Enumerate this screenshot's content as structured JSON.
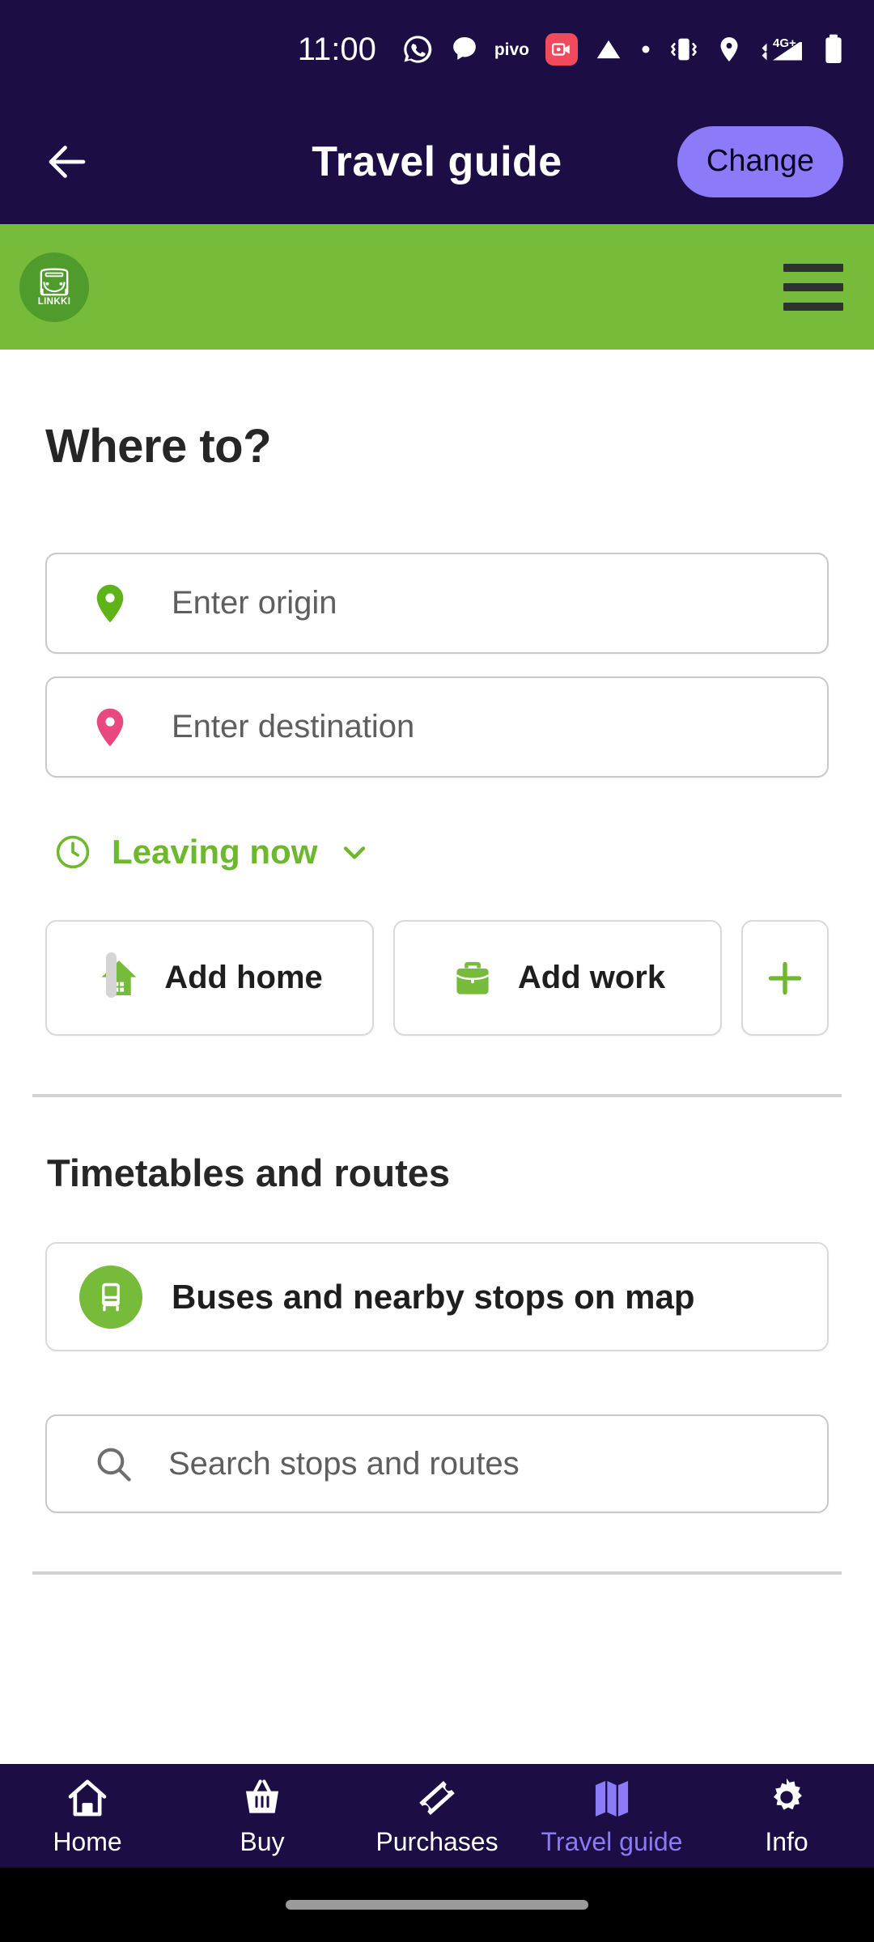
{
  "status_bar": {
    "time": "11:00",
    "pivo_label": "pivo",
    "icons": [
      "whatsapp-icon",
      "messages-icon",
      "pivo-label",
      "screen-record-icon",
      "play-triangle-icon",
      "dot-icon",
      "vibrate-icon",
      "location-icon",
      "signal-4g-icon",
      "battery-icon"
    ],
    "network": "4G+"
  },
  "app_bar": {
    "back_icon": "arrow-left-icon",
    "title": "Travel guide",
    "change_label": "Change",
    "bg_color": "#1C0D45",
    "accent_color": "#8B7BF8"
  },
  "brand_bar": {
    "logo_text": "LINKKI",
    "logo_icon": "bus-front-icon",
    "menu_icon": "hamburger-menu-icon",
    "bg_color": "#76BC3A",
    "logo_bg_color": "#4F9B2B"
  },
  "journey": {
    "heading": "Where to?",
    "origin": {
      "placeholder": "Enter origin",
      "value": "",
      "pin_icon": "map-pin-icon",
      "pin_color": "#5EB318"
    },
    "destination": {
      "placeholder": "Enter destination",
      "value": "",
      "pin_icon": "map-pin-icon",
      "pin_color": "#E8477F"
    },
    "time_option": {
      "label": "Leaving now",
      "clock_icon": "clock-icon",
      "chevron_icon": "chevron-down-icon",
      "color": "#6DB82E"
    },
    "shortcuts": [
      {
        "label": "Add home",
        "icon": "home-icon"
      },
      {
        "label": "Add work",
        "icon": "briefcase-icon"
      },
      {
        "label": "",
        "icon": "plus-icon"
      }
    ]
  },
  "timetables": {
    "heading": "Timetables and routes",
    "map_card": {
      "label": "Buses and nearby stops on map",
      "icon": "bus-icon"
    },
    "search": {
      "placeholder": "Search stops and routes",
      "value": "",
      "icon": "search-icon"
    }
  },
  "bottom_nav": {
    "active": "Travel guide",
    "items": [
      {
        "label": "Home",
        "icon": "home-icon"
      },
      {
        "label": "Buy",
        "icon": "basket-icon"
      },
      {
        "label": "Purchases",
        "icon": "ticket-icon"
      },
      {
        "label": "Travel guide",
        "icon": "map-icon"
      },
      {
        "label": "Info",
        "icon": "gear-icon"
      }
    ]
  }
}
